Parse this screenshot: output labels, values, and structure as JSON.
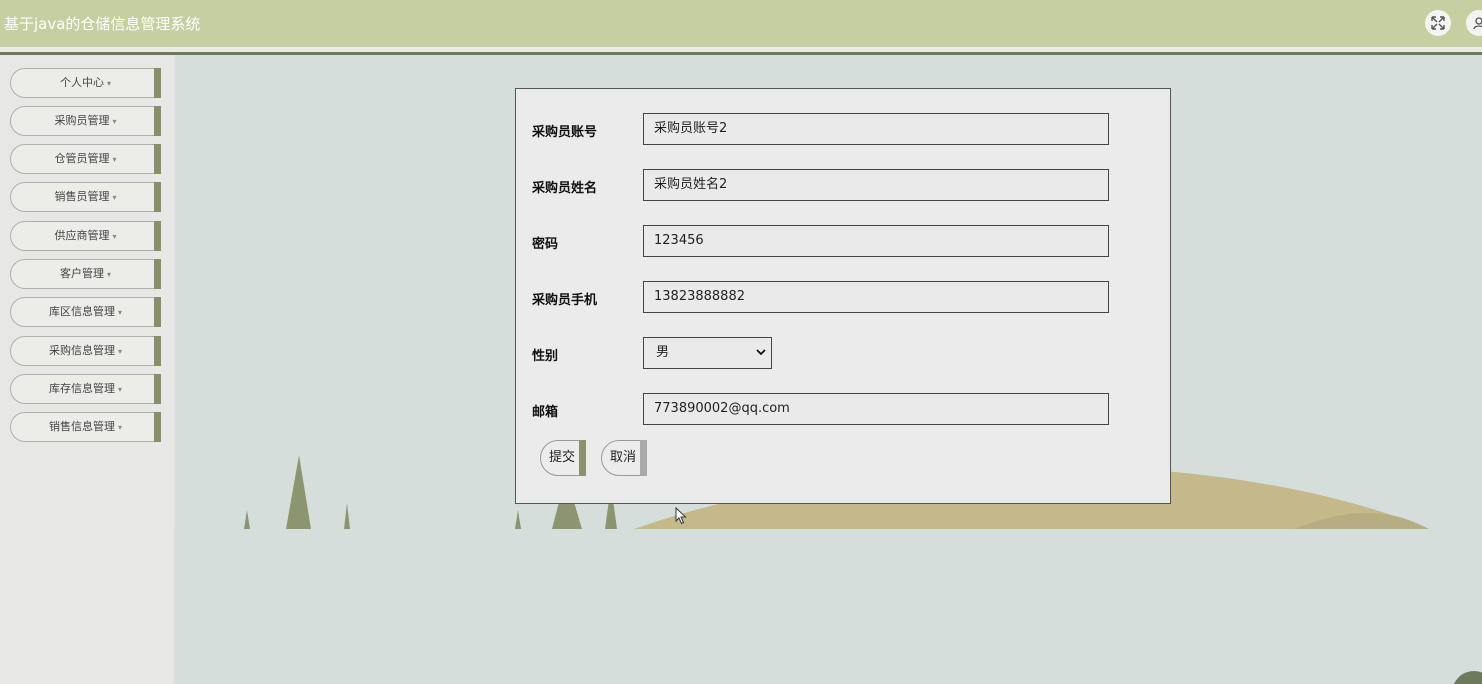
{
  "header": {
    "title": "基于java的仓储信息管理系统",
    "icons": [
      "fullscreen-icon",
      "user-icon"
    ]
  },
  "sidebar": {
    "items": [
      {
        "label": "个人中心"
      },
      {
        "label": "采购员管理"
      },
      {
        "label": "仓管员管理"
      },
      {
        "label": "销售员管理"
      },
      {
        "label": "供应商管理"
      },
      {
        "label": "客户管理"
      },
      {
        "label": "库区信息管理"
      },
      {
        "label": "采购信息管理"
      },
      {
        "label": "库存信息管理"
      },
      {
        "label": "销售信息管理"
      }
    ],
    "caret": "▾"
  },
  "form": {
    "fields": [
      {
        "label": "采购员账号",
        "value": "采购员账号2"
      },
      {
        "label": "采购员姓名",
        "value": "采购员姓名2"
      },
      {
        "label": "密码",
        "value": "123456"
      },
      {
        "label": "采购员手机",
        "value": "13823888882"
      },
      {
        "label": "性别",
        "value": "男"
      },
      {
        "label": "邮箱",
        "value": "773890002@qq.com"
      }
    ],
    "submit_label": "提交",
    "cancel_label": "取消"
  },
  "colors": {
    "header_bg": "#c5cfa1",
    "sidebar_accent": "#858f68",
    "page_bg": "#d4dfdc",
    "hill": "#c5b98c"
  }
}
